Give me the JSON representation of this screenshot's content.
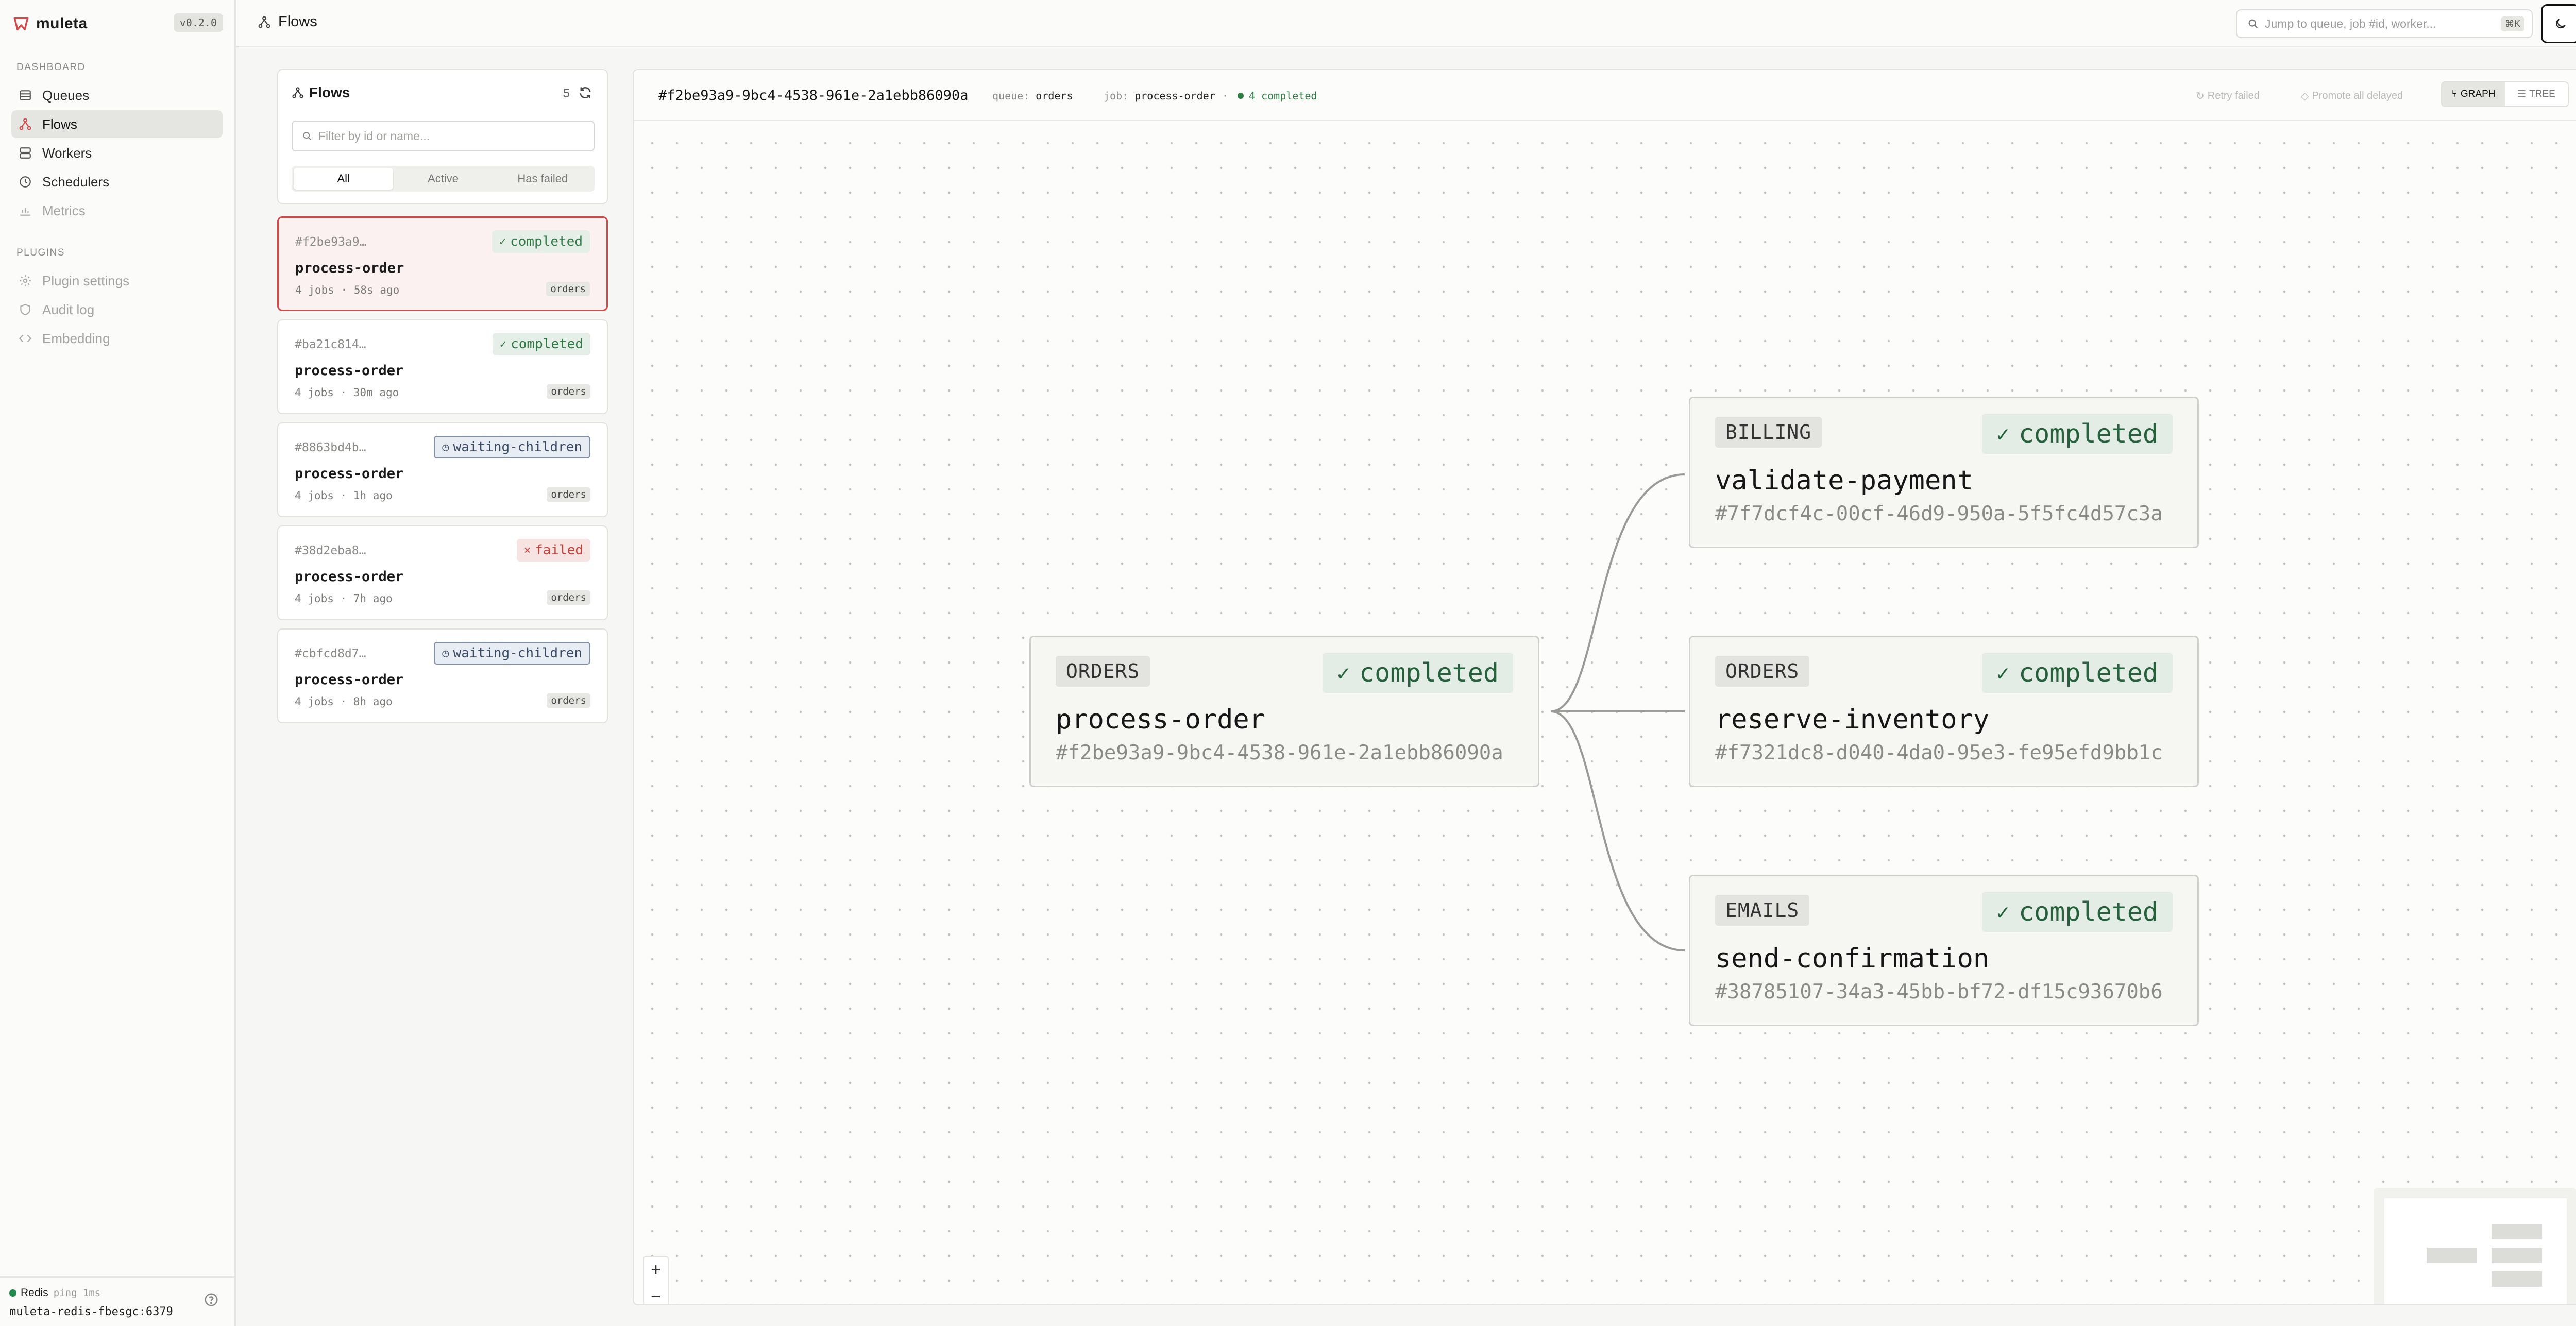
{
  "app": {
    "name": "muleta",
    "version": "v0.2.0"
  },
  "sidebar": {
    "sections": [
      {
        "label": "DASHBOARD",
        "items": [
          {
            "label": "Queues",
            "icon": "queues-icon",
            "active": false
          },
          {
            "label": "Flows",
            "icon": "flows-icon",
            "active": true
          },
          {
            "label": "Workers",
            "icon": "workers-icon",
            "active": false
          },
          {
            "label": "Schedulers",
            "icon": "clock-icon",
            "active": false
          },
          {
            "label": "Metrics",
            "icon": "metrics-icon",
            "active": false
          }
        ]
      },
      {
        "label": "PLUGINS",
        "items": [
          {
            "label": "Plugin settings",
            "icon": "gear-icon"
          },
          {
            "label": "Audit log",
            "icon": "shield-icon"
          },
          {
            "label": "Embedding",
            "icon": "code-icon"
          }
        ]
      }
    ],
    "footer": {
      "redis_label": "Redis",
      "redis_ping": "ping 1ms",
      "redis_host": "muleta-redis-fbesgc:6379"
    }
  },
  "topbar": {
    "breadcrumb": "Flows",
    "search_placeholder": "Jump to queue, job #id, worker...",
    "search_shortcut": "⌘K"
  },
  "flows_panel": {
    "title": "Flows",
    "count": "5",
    "filter_placeholder": "Filter by id or name...",
    "tabs": [
      "All",
      "Active",
      "Has failed"
    ],
    "active_tab": "All"
  },
  "flows": [
    {
      "id": "#f2be93a9…",
      "status": "completed",
      "name": "process-order",
      "meta": "4 jobs · 58s ago",
      "queue": "orders",
      "selected": true
    },
    {
      "id": "#ba21c814…",
      "status": "completed",
      "name": "process-order",
      "meta": "4 jobs · 30m ago",
      "queue": "orders",
      "selected": false
    },
    {
      "id": "#8863bd4b…",
      "status": "waiting-children",
      "name": "process-order",
      "meta": "4 jobs · 1h ago",
      "queue": "orders",
      "selected": false
    },
    {
      "id": "#38d2eba8…",
      "status": "failed",
      "name": "process-order",
      "meta": "4 jobs · 7h ago",
      "queue": "orders",
      "selected": false
    },
    {
      "id": "#cbfcd8d7…",
      "status": "waiting-children",
      "name": "process-order",
      "meta": "4 jobs · 8h ago",
      "queue": "orders",
      "selected": false
    }
  ],
  "flow_detail": {
    "id": "#f2be93a9-9bc4-4538-961e-2a1ebb86090a",
    "queue_label": "queue:",
    "queue": "orders",
    "job_label": "job:",
    "job": "process-order",
    "status": "4 completed",
    "actions": {
      "retry": "Retry failed",
      "promote": "Promote all delayed"
    },
    "view_modes": [
      "GRAPH",
      "TREE"
    ],
    "active_view": "GRAPH"
  },
  "graph": {
    "parent": {
      "queue": "ORDERS",
      "status": "completed",
      "name": "process-order",
      "job_id": "#f2be93a9-9bc4-4538-961e-2a1ebb86090a"
    },
    "children": [
      {
        "queue": "BILLING",
        "status": "completed",
        "name": "validate-payment",
        "job_id": "#7f7dcf4c-00cf-46d9-950a-5f5fc4d57c3a"
      },
      {
        "queue": "ORDERS",
        "status": "completed",
        "name": "reserve-inventory",
        "job_id": "#f7321dc8-d040-4da0-95e3-fe95efd9bb1c"
      },
      {
        "queue": "EMAILS",
        "status": "completed",
        "name": "send-confirmation",
        "job_id": "#38785107-34a3-45bb-bf72-df15c93670b6"
      }
    ]
  },
  "colors": {
    "brand": "#d44848",
    "completed": "#2f7a45",
    "failed": "#c4423a",
    "waiting": "#3a4b66"
  }
}
